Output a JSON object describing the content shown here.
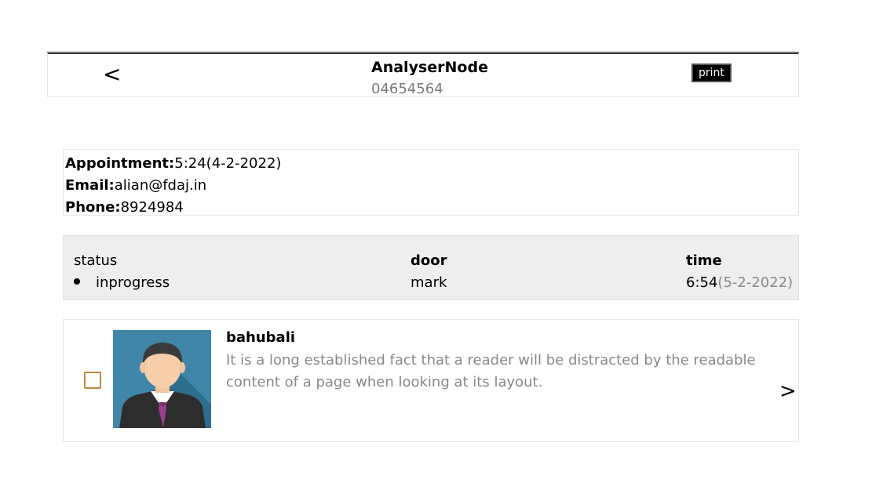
{
  "header": {
    "back_icon": "<",
    "title": "AnalyserNode",
    "subtitle": "04654564",
    "print_label": "print"
  },
  "info": {
    "appointment_label": "Appointment:",
    "appointment_value": "5:24(4-2-2022)",
    "email_label": "Email:",
    "email_value": "alian@fdaj.in",
    "phone_label": "Phone:",
    "phone_value": "8924984"
  },
  "status_table": {
    "status_header": "status",
    "status_value": "inprogress",
    "door_header": "door",
    "door_value": "mark",
    "time_header": "time",
    "time_value": "6:54",
    "time_date": "(5-2-2022)"
  },
  "card": {
    "name": "bahubali",
    "description": "It is a long established fact that a reader will be distracted by the readable content of a page when looking at its layout.",
    "next_icon": ">",
    "checked": false
  }
}
